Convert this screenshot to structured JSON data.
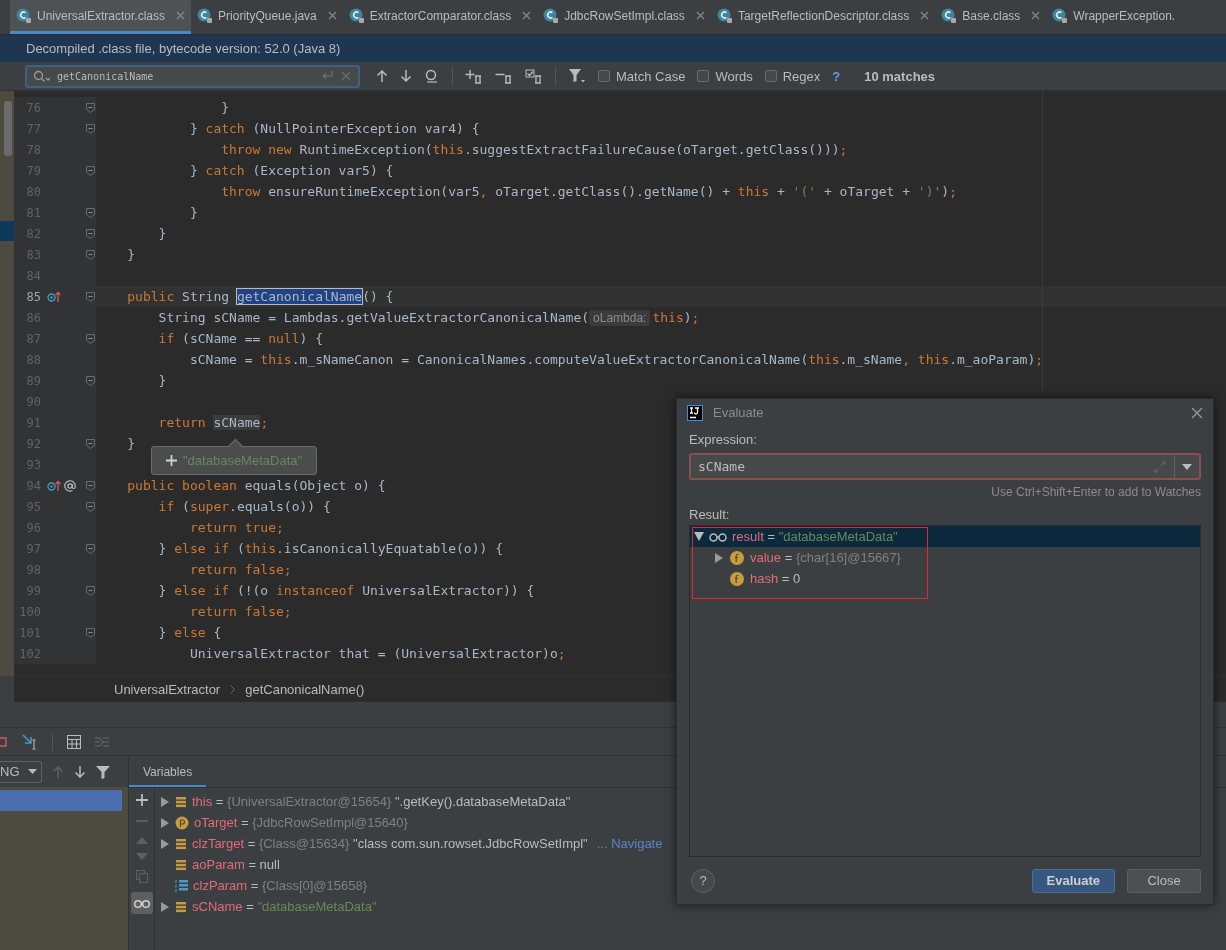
{
  "tabs": [
    {
      "label": "UniversalExtractor.class",
      "selected": true,
      "closable": true
    },
    {
      "label": "PriorityQueue.java",
      "selected": false,
      "closable": true
    },
    {
      "label": "ExtractorComparator.class",
      "selected": false,
      "closable": true
    },
    {
      "label": "JdbcRowSetImpl.class",
      "selected": false,
      "closable": true
    },
    {
      "label": "TargetReflectionDescriptor.class",
      "selected": false,
      "closable": true
    },
    {
      "label": "Base.class",
      "selected": false,
      "closable": true
    },
    {
      "label": "WrapperException.",
      "selected": false,
      "closable": false
    }
  ],
  "info_bar": "Decompiled .class file, bytecode version: 52.0 (Java 8)",
  "find_bar": {
    "query": "getCanonicalName",
    "options": [
      {
        "label": "Match Case",
        "checked": false
      },
      {
        "label": "Words",
        "checked": false
      },
      {
        "label": "Regex",
        "checked": false
      }
    ],
    "help": "?",
    "matches": "10 matches"
  },
  "editor": {
    "lines": [
      {
        "n": "76",
        "fold": true,
        "current": false,
        "tokens": [
          {
            "kind": "p",
            "text": "                }"
          }
        ]
      },
      {
        "n": "77",
        "fold": true,
        "current": false,
        "tokens": [
          {
            "kind": "p",
            "text": "            } "
          },
          {
            "kind": "k",
            "text": "catch"
          },
          {
            "kind": "p",
            "text": " (NullPointerException var4) {"
          }
        ]
      },
      {
        "n": "78",
        "fold": false,
        "current": false,
        "tokens": [
          {
            "kind": "k",
            "text": "                throw new "
          },
          {
            "kind": "p",
            "text": "RuntimeException("
          },
          {
            "kind": "k",
            "text": "this"
          },
          {
            "kind": "p",
            "text": ".suggestExtractFailureCause(oTarget.getClass()))"
          },
          {
            "kind": "k",
            "text": ";"
          }
        ]
      },
      {
        "n": "79",
        "fold": true,
        "current": false,
        "tokens": [
          {
            "kind": "p",
            "text": "            } "
          },
          {
            "kind": "k",
            "text": "catch"
          },
          {
            "kind": "p",
            "text": " (Exception var5) {"
          }
        ]
      },
      {
        "n": "80",
        "fold": false,
        "current": false,
        "tokens": [
          {
            "kind": "k",
            "text": "                throw "
          },
          {
            "kind": "p",
            "text": "ensureRuntimeException(var5"
          },
          {
            "kind": "k",
            "text": ", "
          },
          {
            "kind": "p",
            "text": "oTarget.getClass().getName() + "
          },
          {
            "kind": "k",
            "text": "this "
          },
          {
            "kind": "p",
            "text": "+ "
          },
          {
            "kind": "s",
            "text": "'('"
          },
          {
            "kind": "p",
            "text": " + oTarget + "
          },
          {
            "kind": "s",
            "text": "')'"
          },
          {
            "kind": "p",
            "text": ")"
          },
          {
            "kind": "k",
            "text": ";"
          }
        ]
      },
      {
        "n": "81",
        "fold": true,
        "current": false,
        "tokens": [
          {
            "kind": "p",
            "text": "            }"
          }
        ]
      },
      {
        "n": "82",
        "fold": true,
        "current": false,
        "tokens": [
          {
            "kind": "p",
            "text": "        }"
          }
        ]
      },
      {
        "n": "83",
        "fold": true,
        "current": false,
        "tokens": [
          {
            "kind": "p",
            "text": "    }"
          }
        ]
      },
      {
        "n": "84",
        "fold": false,
        "current": false
      },
      {
        "n": "85",
        "fold": true,
        "current": true,
        "kind": "override",
        "tokens": [
          {
            "kind": "k",
            "text": "    public "
          },
          {
            "kind": "p",
            "text": "String "
          },
          {
            "kind": "m",
            "text": "getCanonicalName"
          },
          {
            "kind": "p",
            "text": "() {"
          }
        ]
      },
      {
        "n": "86",
        "fold": false,
        "current": false,
        "tokens": [
          {
            "kind": "p",
            "text": "        String sCName = Lambdas.getValueExtractorCanonicalName("
          },
          {
            "kind": "h",
            "text": "oLambda:"
          },
          {
            "kind": "k",
            "text": "this"
          },
          {
            "kind": "p",
            "text": ")"
          },
          {
            "kind": "k",
            "text": ";"
          }
        ]
      },
      {
        "n": "87",
        "fold": true,
        "current": false,
        "tokens": [
          {
            "kind": "k",
            "text": "        if "
          },
          {
            "kind": "p",
            "text": "(sCName == "
          },
          {
            "kind": "k",
            "text": "null"
          },
          {
            "kind": "p",
            "text": ") {"
          }
        ]
      },
      {
        "n": "88",
        "fold": false,
        "current": false,
        "tokens": [
          {
            "kind": "p",
            "text": "            sCName = "
          },
          {
            "kind": "k",
            "text": "this"
          },
          {
            "kind": "p",
            "text": ".m_sNameCanon = CanonicalNames.computeValueExtractorCanonicalName("
          },
          {
            "kind": "k",
            "text": "this"
          },
          {
            "kind": "p",
            "text": ".m_sName"
          },
          {
            "kind": "k",
            "text": ", this"
          },
          {
            "kind": "p",
            "text": ".m_aoParam)"
          },
          {
            "kind": "k",
            "text": ";"
          }
        ]
      },
      {
        "n": "89",
        "fold": true,
        "current": false,
        "tokens": [
          {
            "kind": "p",
            "text": "        }"
          }
        ]
      },
      {
        "n": "90",
        "fold": false,
        "current": false
      },
      {
        "n": "91",
        "fold": false,
        "current": false,
        "tokens": [
          {
            "kind": "k",
            "text": "        return "
          },
          {
            "kind": "r",
            "text": "sCName"
          },
          {
            "kind": "k",
            "text": ";"
          }
        ]
      },
      {
        "n": "92",
        "fold": true,
        "current": false,
        "tokens": [
          {
            "kind": "p",
            "text": "    }"
          }
        ]
      },
      {
        "n": "93",
        "fold": false,
        "current": false
      },
      {
        "n": "94",
        "fold": true,
        "current": false,
        "kind": "override-annotated",
        "tokens": [
          {
            "kind": "k",
            "text": "    public boolean "
          },
          {
            "kind": "p",
            "text": "equals(Object o) {"
          }
        ]
      },
      {
        "n": "95",
        "fold": true,
        "current": false,
        "tokens": [
          {
            "kind": "k",
            "text": "        if "
          },
          {
            "kind": "p",
            "text": "("
          },
          {
            "kind": "k",
            "text": "super"
          },
          {
            "kind": "p",
            "text": ".equals(o)) {"
          }
        ]
      },
      {
        "n": "96",
        "fold": false,
        "current": false,
        "tokens": [
          {
            "kind": "k",
            "text": "            return true;"
          }
        ]
      },
      {
        "n": "97",
        "fold": true,
        "current": false,
        "tokens": [
          {
            "kind": "p",
            "text": "        } "
          },
          {
            "kind": "k",
            "text": "else if "
          },
          {
            "kind": "p",
            "text": "("
          },
          {
            "kind": "k",
            "text": "this"
          },
          {
            "kind": "p",
            "text": ".isCanonicallyEquatable(o)) {"
          }
        ]
      },
      {
        "n": "98",
        "fold": false,
        "current": false,
        "tokens": [
          {
            "kind": "k",
            "text": "            return false;"
          }
        ]
      },
      {
        "n": "99",
        "fold": true,
        "current": false,
        "tokens": [
          {
            "kind": "p",
            "text": "        } "
          },
          {
            "kind": "k",
            "text": "else if "
          },
          {
            "kind": "p",
            "text": "(!(o "
          },
          {
            "kind": "k",
            "text": "instanceof "
          },
          {
            "kind": "p",
            "text": "UniversalExtractor)) {"
          }
        ]
      },
      {
        "n": "100",
        "fold": false,
        "current": false,
        "tokens": [
          {
            "kind": "k",
            "text": "            return false;"
          }
        ]
      },
      {
        "n": "101",
        "fold": true,
        "current": false,
        "tokens": [
          {
            "kind": "p",
            "text": "        } "
          },
          {
            "kind": "k",
            "text": "else "
          },
          {
            "kind": "p",
            "text": "{"
          }
        ]
      },
      {
        "n": "102",
        "fold": false,
        "current": false,
        "tokens": [
          {
            "kind": "p",
            "text": "            UniversalExtractor that = (UniversalExtractor)o"
          },
          {
            "kind": "k",
            "text": ";"
          }
        ]
      }
    ],
    "value_popup": "\"databaseMetaData\""
  },
  "breadcrumbs": [
    "UniversalExtractor",
    "getCanonicalName()"
  ],
  "debugger": {
    "thread_dropdown": "NG",
    "variables_tab": "Variables",
    "variables": [
      {
        "expandable": true,
        "expanded": false,
        "kind": "field",
        "name": "this",
        "op": "=",
        "ref": "{UniversalExtractor@15654}",
        "value": "\".getKey().databaseMetaData\"",
        "is_string": false
      },
      {
        "expandable": true,
        "expanded": false,
        "kind": "param",
        "name": "oTarget",
        "op": "=",
        "ref": "{JdbcRowSetImpl@15640}"
      },
      {
        "expandable": true,
        "expanded": false,
        "kind": "field",
        "name": "clzTarget",
        "op": "=",
        "ref": "{Class@15634}",
        "value": "\"class com.sun.rowset.JdbcRowSetImpl\"",
        "is_string": false,
        "link": "... Navigate"
      },
      {
        "expandable": false,
        "kind": "field",
        "name": "aoParam",
        "op": "=",
        "value": "null",
        "is_string": false
      },
      {
        "expandable": false,
        "kind": "array",
        "name": "clzParam",
        "op": "=",
        "ref": "{Class[0]@15658}"
      },
      {
        "expandable": true,
        "expanded": false,
        "kind": "field",
        "name": "sCName",
        "op": "=",
        "value": "\"databaseMetaData\"",
        "is_string": true
      }
    ]
  },
  "evaluate_dialog": {
    "title": "Evaluate",
    "expression_label": "Expression:",
    "expression": "sCName",
    "hint": "Use Ctrl+Shift+Enter to add to Watches",
    "result_label": "Result:",
    "result": [
      {
        "expandable": true,
        "expanded": true,
        "kind": "watch",
        "selected": true,
        "name": "result",
        "op": "=",
        "value": "\"databaseMetaData\"",
        "is_string": true,
        "children": [
          {
            "expandable": true,
            "expanded": false,
            "kind": "field",
            "selected": false,
            "name": "value",
            "op": "=",
            "ref": "{char[16]@15667}"
          },
          {
            "expandable": false,
            "kind": "field",
            "selected": false,
            "name": "hash",
            "op": "=",
            "value": "0",
            "is_string": false
          }
        ]
      }
    ],
    "help": "?",
    "buttons": [
      {
        "label": "Evaluate",
        "kind": "default"
      },
      {
        "label": "Close",
        "kind": "normal"
      }
    ]
  }
}
